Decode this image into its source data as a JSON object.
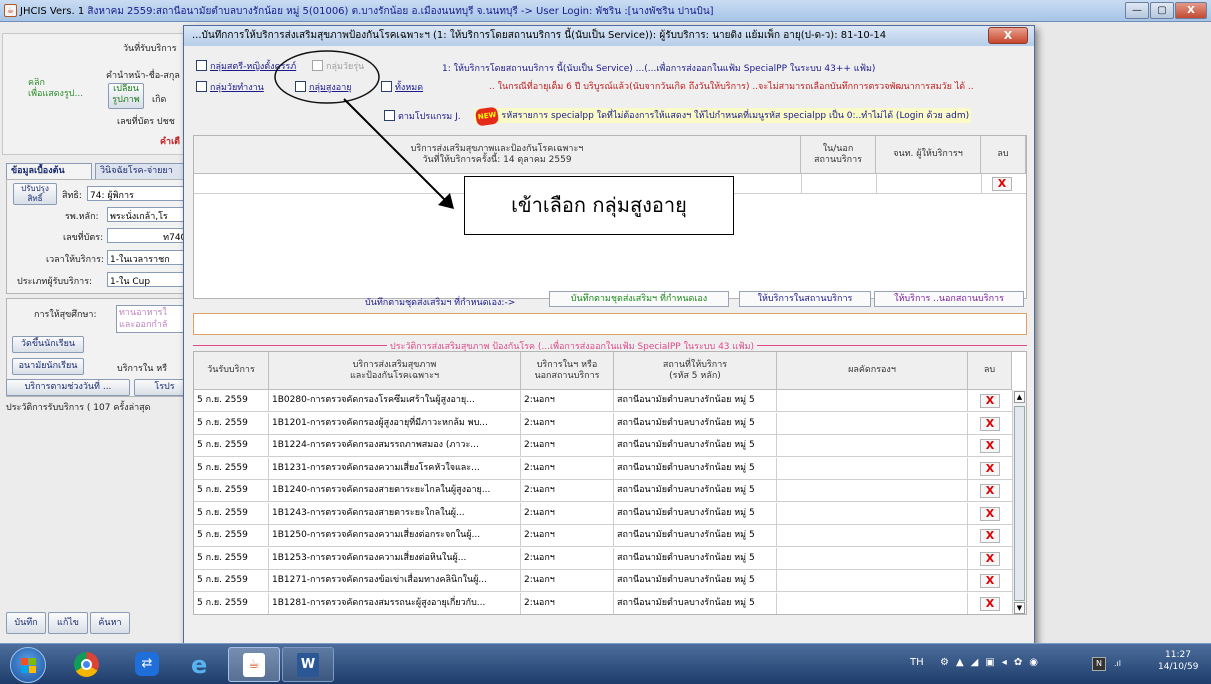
{
  "main_window": {
    "title_prefix": "JHCIS Vers. 1",
    "title_rest": "สิงหาคม 2559:สถานีอนามัยตำบลบางรักน้อย หมู่ 5(01006) ต.บางรักน้อย อ.เมืองนนทบุรี จ.นนทบุรี -> User Login: พัชริน :[นางพัชริน ปานบิน]",
    "buttons": [
      "—",
      "▢",
      "X"
    ]
  },
  "left_panel": {
    "service_date_label": "วันที่รับบริการ",
    "name_label": "คำนำหน้า-ชื่อ-สกุล",
    "click_text": "คลิ๊ก\nเพื่อแสดงรูป...",
    "change_photo_button": "เปลี่ยน\nรูปภาพ",
    "birth_label": "เกิด",
    "id_card_label": "เลขที่บัตร ปชช",
    "red_label": "คำเตื",
    "tabs": [
      "ข้อมูลเบื้องต้น",
      "วินิจฉัยโรค-จ่ายยา"
    ],
    "update_rights_button": "ปรับปรุง\nสิทธิ์",
    "rights_label": "สิทธิ:",
    "rights_value": "74: ผู้พิการ",
    "main_hosp_label": "รพ.หลัก:",
    "main_hosp_value": "พระนั่งเกล้า,โร",
    "card_no_label": "เลขที่บัตร:",
    "card_no_value": "ท7400",
    "service_time_label": "เวลาให้บริการ:",
    "service_time_value": "1-ในเวลาราชก",
    "patient_type_label": "ประเภทผู้รับบริการ:",
    "patient_type_value": "1-ใน Cup",
    "health_ed_label": "การให้สุขศึกษา:",
    "health_ed_value": "ทานอาหารใ\nและออกกำลั",
    "measure_students_button": "วัดขึ้นนักเรียน",
    "school_health_button": "อนามัยนักเรียน",
    "service_in_label": "บริการใน หรื",
    "follow_up_button": "บริการตามช่วงวันที่ ...",
    "program_button": "โรปร",
    "history_count": "ประวัติการรับบริการ ( 107 ครั้งล่าสุด",
    "bottom_buttons": [
      "บันทึก",
      "แก้ไข",
      "ค้นหา"
    ]
  },
  "dialog": {
    "title": "...บันทึกการให้บริการส่งเสริมสุขภาพป้องกันโรคเฉพาะฯ (1: ให้บริการโดยสถานบริการ นี้(นับเป็น Service)): ผู้รับบริการ: นายดิง แย้มเพ็ก อายุ(ป-ด-ว): 81-10-14",
    "close_label": "X",
    "groups": {
      "pregnant": "กลุ่มสตรี-หญิงตั้งครรภ์",
      "teen": "กลุ่มวัยรุ่น",
      "working": "กลุ่มวัยทำงาน",
      "elderly": "กลุ่มสูงอายุ",
      "all": "ทั้งหมด",
      "by_program": "ตามโปรแกรม J."
    },
    "note_service": "1: ให้บริการโดยสถานบริการ นี้(นับเป็น Service) ...(...เพื่อการส่งออกในแฟ้ม SpecialPP ในระบบ 43++ แฟ้ม)",
    "note_warning": ".. ในกรณีที่อายุเต็ม 6 ปี บริบูรณ์แล้ว(นับจากวันเกิด ถึงวันให้บริการ) ..จะไม่สามารถเลือกบันทึกการตรวจพัฒนาการสมวัย ได้ ..",
    "new_badge": "NEW",
    "note_code": "รหัสรายการ specialpp ใดที่ไม่ต้องการให้แสดงฯ ให้ไปกำหนดที่เมนูรหัส specialpp เป็น 0:..ทำไม่ได้ (Login ด้วย adm)",
    "top_table": {
      "col_service": "บริการส่งเสริมสุขภาพและป้องกันโรคเฉพาะฯ\nวันที่ให้บริการครั้งนี้: 14 ตุลาคม 2559",
      "col_place": "ใน/นอก\nสถานบริการ",
      "col_staff": "จนท. ผู้ให้บริการฯ",
      "col_delete": "ลบ",
      "delete_mark": "X"
    },
    "annotation": "เข้าเลือก กลุ่มสูงอายุ",
    "link_prompt": "บันทึกตามชุดส่งเสริมฯ ที่กำหนดเอง:->",
    "link_buttons": [
      "บันทึกตามชุดส่งเสริมฯ ที่กำหนดเอง",
      "ให้บริการในสถานบริการ",
      "ให้บริการ ..นอกสถานบริการ"
    ],
    "history_title": "ประวัติการส่งเสริมสุขภาพ ป้องกันโรค (...เพื่อการส่งออกในแฟ้ม SpecialPP ในระบบ 43 แฟ้ม)",
    "history_headers": [
      "วันรับบริการ",
      "บริการส่งเสริมสุขภาพ\nและป้องกันโรคเฉพาะฯ",
      "บริการในฯ หรือ\nนอกสถานบริการ",
      "สถานที่ให้บริการ\n(รหัส 5 หลัก)",
      "ผลคัดกรองฯ",
      "ลบ"
    ],
    "history_rows": [
      {
        "date": "5 ก.ย. 2559",
        "service": "1B0280-การตรวจคัดกรองโรคซึมเศร้าในผู้สูงอายุ...",
        "place": "2:นอกฯ",
        "location": "สถานีอนามัยตำบลบางรักน้อย หมู่ 5",
        "result": "",
        "del": "X"
      },
      {
        "date": "5 ก.ย. 2559",
        "service": "1B1201-การตรวจคัดกรองผู้สูงอายุที่มีภาวะหกล้ม พบ...",
        "place": "2:นอกฯ",
        "location": "สถานีอนามัยตำบลบางรักน้อย หมู่ 5",
        "result": "",
        "del": "X"
      },
      {
        "date": "5 ก.ย. 2559",
        "service": "1B1224-การตรวจคัดกรองสมรรถภาพสมอง (ภาวะ...",
        "place": "2:นอกฯ",
        "location": "สถานีอนามัยตำบลบางรักน้อย หมู่ 5",
        "result": "",
        "del": "X"
      },
      {
        "date": "5 ก.ย. 2559",
        "service": "1B1231-การตรวจคัดกรองความเสี่ยงโรคหัวใจและ...",
        "place": "2:นอกฯ",
        "location": "สถานีอนามัยตำบลบางรักน้อย หมู่ 5",
        "result": "",
        "del": "X"
      },
      {
        "date": "5 ก.ย. 2559",
        "service": "1B1240-การตรวจคัดกรองสายตาระยะไกลในผู้สูงอายุ...",
        "place": "2:นอกฯ",
        "location": "สถานีอนามัยตำบลบางรักน้อย หมู่ 5",
        "result": "",
        "del": "X"
      },
      {
        "date": "5 ก.ย. 2559",
        "service": "1B1243-การตรวจคัดกรองสายตาระยะใกลในผู้...",
        "place": "2:นอกฯ",
        "location": "สถานีอนามัยตำบลบางรักน้อย หมู่ 5",
        "result": "",
        "del": "X"
      },
      {
        "date": "5 ก.ย. 2559",
        "service": "1B1250-การตรวจคัดกรองความเสี่ยงต่อกระจกในผู้...",
        "place": "2:นอกฯ",
        "location": "สถานีอนามัยตำบลบางรักน้อย หมู่ 5",
        "result": "",
        "del": "X"
      },
      {
        "date": "5 ก.ย. 2559",
        "service": "1B1253-การตรวจคัดกรองความเสี่ยงต่อหินในผู้...",
        "place": "2:นอกฯ",
        "location": "สถานีอนามัยตำบลบางรักน้อย หมู่ 5",
        "result": "",
        "del": "X"
      },
      {
        "date": "5 ก.ย. 2559",
        "service": "1B1271-การตรวจคัดกรองข้อเข่าเสื่อมทางคลินิกในผู้...",
        "place": "2:นอกฯ",
        "location": "สถานีอนามัยตำบลบางรักน้อย หมู่ 5",
        "result": "",
        "del": "X"
      },
      {
        "date": "5 ก.ย. 2559",
        "service": "1B1281-การตรวจคัดกรองสมรรถนะผู้สูงอายุเกี่ยวกับ...",
        "place": "2:นอกฯ",
        "location": "สถานีอนามัยตำบลบางรักน้อย หมู่ 5",
        "result": "",
        "del": "X"
      }
    ]
  },
  "taskbar": {
    "lang": "TH",
    "time": "11:27",
    "date": "14/10/59"
  }
}
